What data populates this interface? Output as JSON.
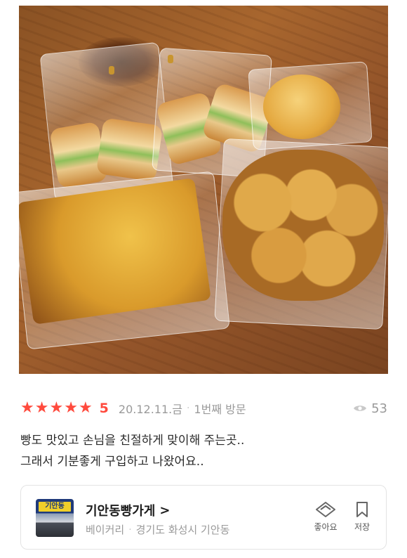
{
  "photo": {
    "alt": ""
  },
  "review": {
    "rating": 5,
    "rating_label": "5",
    "stars": [
      "★",
      "★",
      "★",
      "★",
      "★"
    ],
    "date": "20.12.11.금",
    "separator": "·",
    "visit": "1번째 방문",
    "views": "53",
    "text_lines": [
      "빵도 맛있고 손님을 친절하게 맞이해 주는곳..",
      "그래서 기분좋게 구입하고 나왔어요.."
    ]
  },
  "place": {
    "thumb_sign": "기안동",
    "name": "기안동빵가게",
    "name_chevron": ">",
    "category": "베이커리",
    "separator": "·",
    "address": "경기도 화성시 기안동"
  },
  "actions": {
    "like_label": "좋아요",
    "save_label": "저장"
  },
  "colors": {
    "accent": "#ff4a3d",
    "muted": "#9a9a9a",
    "border": "#e3e3e3"
  },
  "icons": {
    "star": "star-icon",
    "views": "eye-icon",
    "like": "heart-diamond-icon",
    "save": "bookmark-icon"
  }
}
